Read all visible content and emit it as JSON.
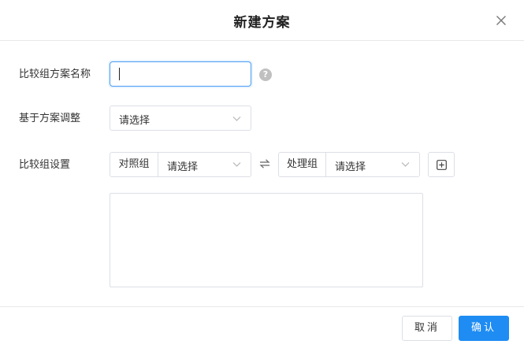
{
  "dialog": {
    "title": "新建方案",
    "close_icon": "close-icon"
  },
  "form": {
    "name": {
      "label": "比较组方案名称",
      "value": "",
      "help_icon": "question-icon",
      "help_glyph": "?"
    },
    "base": {
      "label": "基于方案调整",
      "select_value": "请选择"
    },
    "group_settings": {
      "label": "比较组设置",
      "control": {
        "prefix": "对照组",
        "select_value": "请选择"
      },
      "swap_icon": "swap-icon",
      "treatment": {
        "prefix": "处理组",
        "select_value": "请选择"
      },
      "add_icon": "plus-square-icon"
    }
  },
  "footer": {
    "cancel_label": "取消",
    "ok_label": "确认"
  },
  "colors": {
    "accent": "#1e8cf3",
    "focus_border": "#4a9cf1",
    "border": "#dcdfe6"
  }
}
